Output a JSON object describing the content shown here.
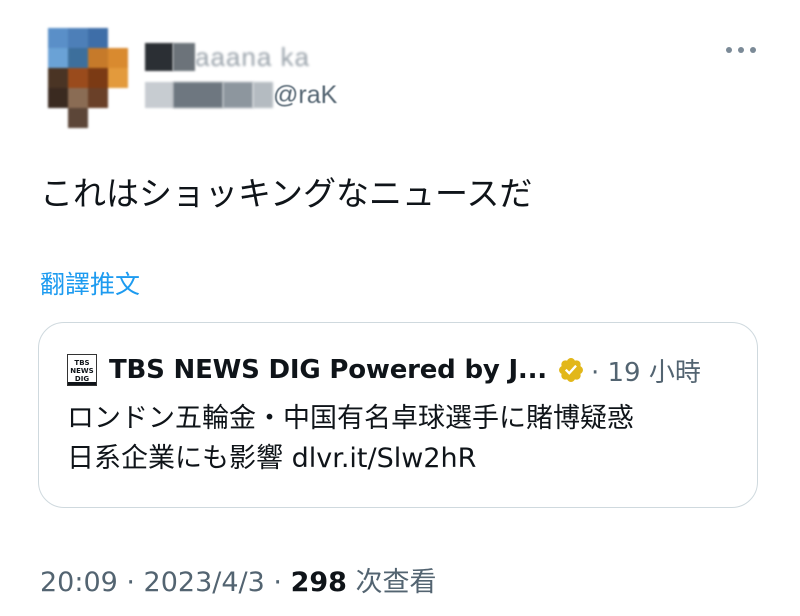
{
  "author": {
    "display_name": "aaana ka",
    "handle": "@raK"
  },
  "tweet": {
    "text": "これはショッキングなニュースだ",
    "translate_label": "翻譯推文"
  },
  "quoted": {
    "logo_lines": [
      "TBS",
      "NEWS",
      "DIG"
    ],
    "source_name": "TBS NEWS DIG Powered by J...",
    "meta": "· 19 小時",
    "line1": "ロンドン五輪金・中国有名卓球選手に賭博疑惑",
    "line2": "日系企業にも影響 dlvr.it/Slw2hR",
    "verified_color": "#e2b719"
  },
  "footer": {
    "time": "20:09 · 2023/4/3 · ",
    "views_count": "298",
    "views_label": " 次查看"
  },
  "icons": {
    "more": "more-horizontal-icon",
    "verified": "verified-badge-icon"
  }
}
